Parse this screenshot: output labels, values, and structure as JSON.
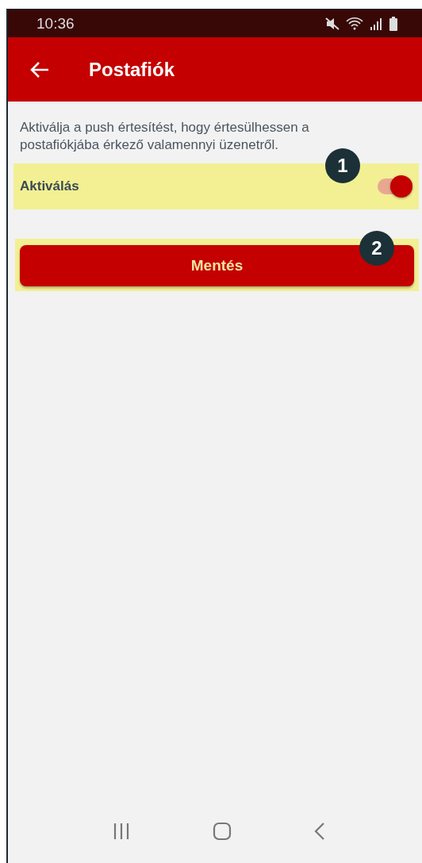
{
  "status_bar": {
    "time": "10:36"
  },
  "app_bar": {
    "title": "Postafiók"
  },
  "description": "Aktiválja a push értesítést, hogy értesülhessen a postafiókjába érkező valamennyi üzenetről.",
  "toggle": {
    "label": "Aktiválás",
    "on": true,
    "highlighted": true,
    "marker": "1"
  },
  "save_button": {
    "label": "Mentés",
    "highlighted": true,
    "marker": "2"
  }
}
